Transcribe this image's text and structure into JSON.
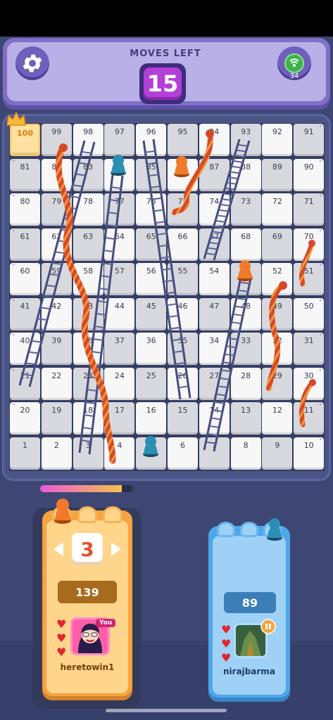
{
  "header": {
    "moves_label": "MOVES LEFT",
    "moves_left": "15",
    "ping": "34"
  },
  "board": {
    "rows": [
      [
        100,
        99,
        98,
        97,
        96,
        95,
        94,
        93,
        92,
        91
      ],
      [
        81,
        82,
        83,
        84,
        85,
        86,
        87,
        88,
        89,
        90
      ],
      [
        80,
        79,
        78,
        77,
        76,
        75,
        74,
        73,
        72,
        71
      ],
      [
        61,
        62,
        63,
        64,
        65,
        66,
        67,
        68,
        69,
        70
      ],
      [
        60,
        59,
        58,
        57,
        56,
        55,
        54,
        53,
        52,
        51
      ],
      [
        41,
        42,
        43,
        44,
        45,
        46,
        47,
        48,
        49,
        50
      ],
      [
        40,
        39,
        38,
        37,
        36,
        35,
        34,
        33,
        32,
        31
      ],
      [
        21,
        22,
        23,
        24,
        25,
        26,
        27,
        28,
        29,
        30
      ],
      [
        20,
        19,
        18,
        17,
        16,
        15,
        14,
        13,
        12,
        11
      ],
      [
        1,
        2,
        3,
        4,
        5,
        6,
        7,
        8,
        9,
        10
      ]
    ]
  },
  "turn_timer_fraction": 0.88,
  "player1": {
    "dice_value": "3",
    "score": "139",
    "you_tag": "You",
    "name": "heretowin1",
    "lives": 3,
    "color": "#f5a43f"
  },
  "player2": {
    "score": "89",
    "name": "nirajbarma",
    "lives": 3,
    "color": "#4fa7ea"
  },
  "icons": {
    "settings": "gear-icon",
    "network": "signal-icon",
    "crown": "crown-icon",
    "heart": "heart-icon"
  }
}
